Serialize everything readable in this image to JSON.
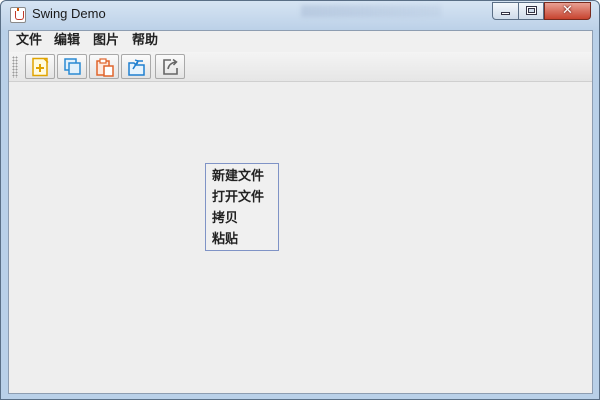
{
  "window": {
    "title": "Swing Demo",
    "controls": {
      "minimize_icon": "minimize-icon",
      "maximize_icon": "maximize-icon",
      "close_glyph": "✕"
    }
  },
  "menubar": {
    "items": [
      {
        "label": "文件"
      },
      {
        "label": "编辑"
      },
      {
        "label": "图片"
      },
      {
        "label": "帮助"
      }
    ]
  },
  "toolbar": {
    "buttons": [
      {
        "icon": "new-file-icon"
      },
      {
        "icon": "copy-icon"
      },
      {
        "icon": "paste-icon"
      },
      {
        "icon": "open-file-icon"
      },
      {
        "icon": "export-icon"
      }
    ]
  },
  "popup_menu": {
    "items": [
      {
        "label": "新建文件"
      },
      {
        "label": "打开文件"
      },
      {
        "label": "拷贝"
      },
      {
        "label": "粘贴"
      }
    ]
  },
  "colors": {
    "titlebar": "#bcd1e8",
    "client_bg": "#eeeeee",
    "popup_border": "#7f93c6",
    "close_button": "#c7432f"
  }
}
